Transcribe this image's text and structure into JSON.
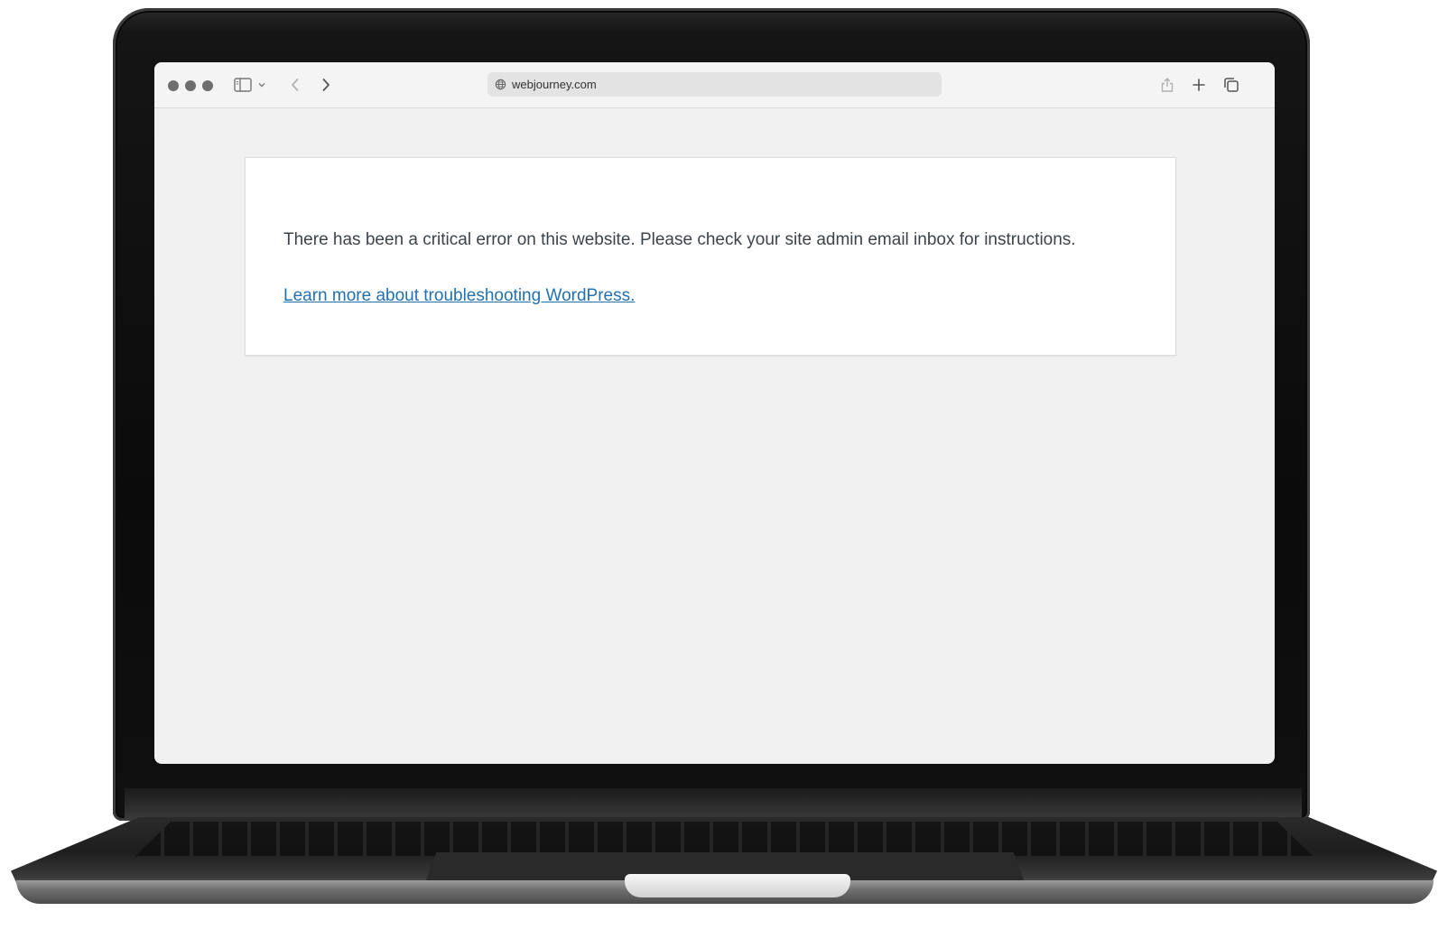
{
  "browser": {
    "url": "webjourney.com",
    "icons": {
      "window_controls": [
        "close-dot",
        "minimize-dot",
        "zoom-dot"
      ],
      "sidebar": "sidebar-toggle-icon",
      "sidebar_menu": "chevron-down-icon",
      "back": "chevron-left-icon",
      "forward": "chevron-right-icon",
      "site": "globe-icon",
      "share": "share-icon",
      "new_tab": "plus-icon",
      "tabs": "tab-overview-icon"
    }
  },
  "page": {
    "error_message": "There has been a critical error on this website. Please check your site admin email inbox for instructions.",
    "link_text": "Learn more about troubleshooting WordPress."
  },
  "colors": {
    "page_background": "#f0f0f0",
    "card_background": "#ffffff",
    "text": "#3c434a",
    "link": "#2271b1"
  }
}
